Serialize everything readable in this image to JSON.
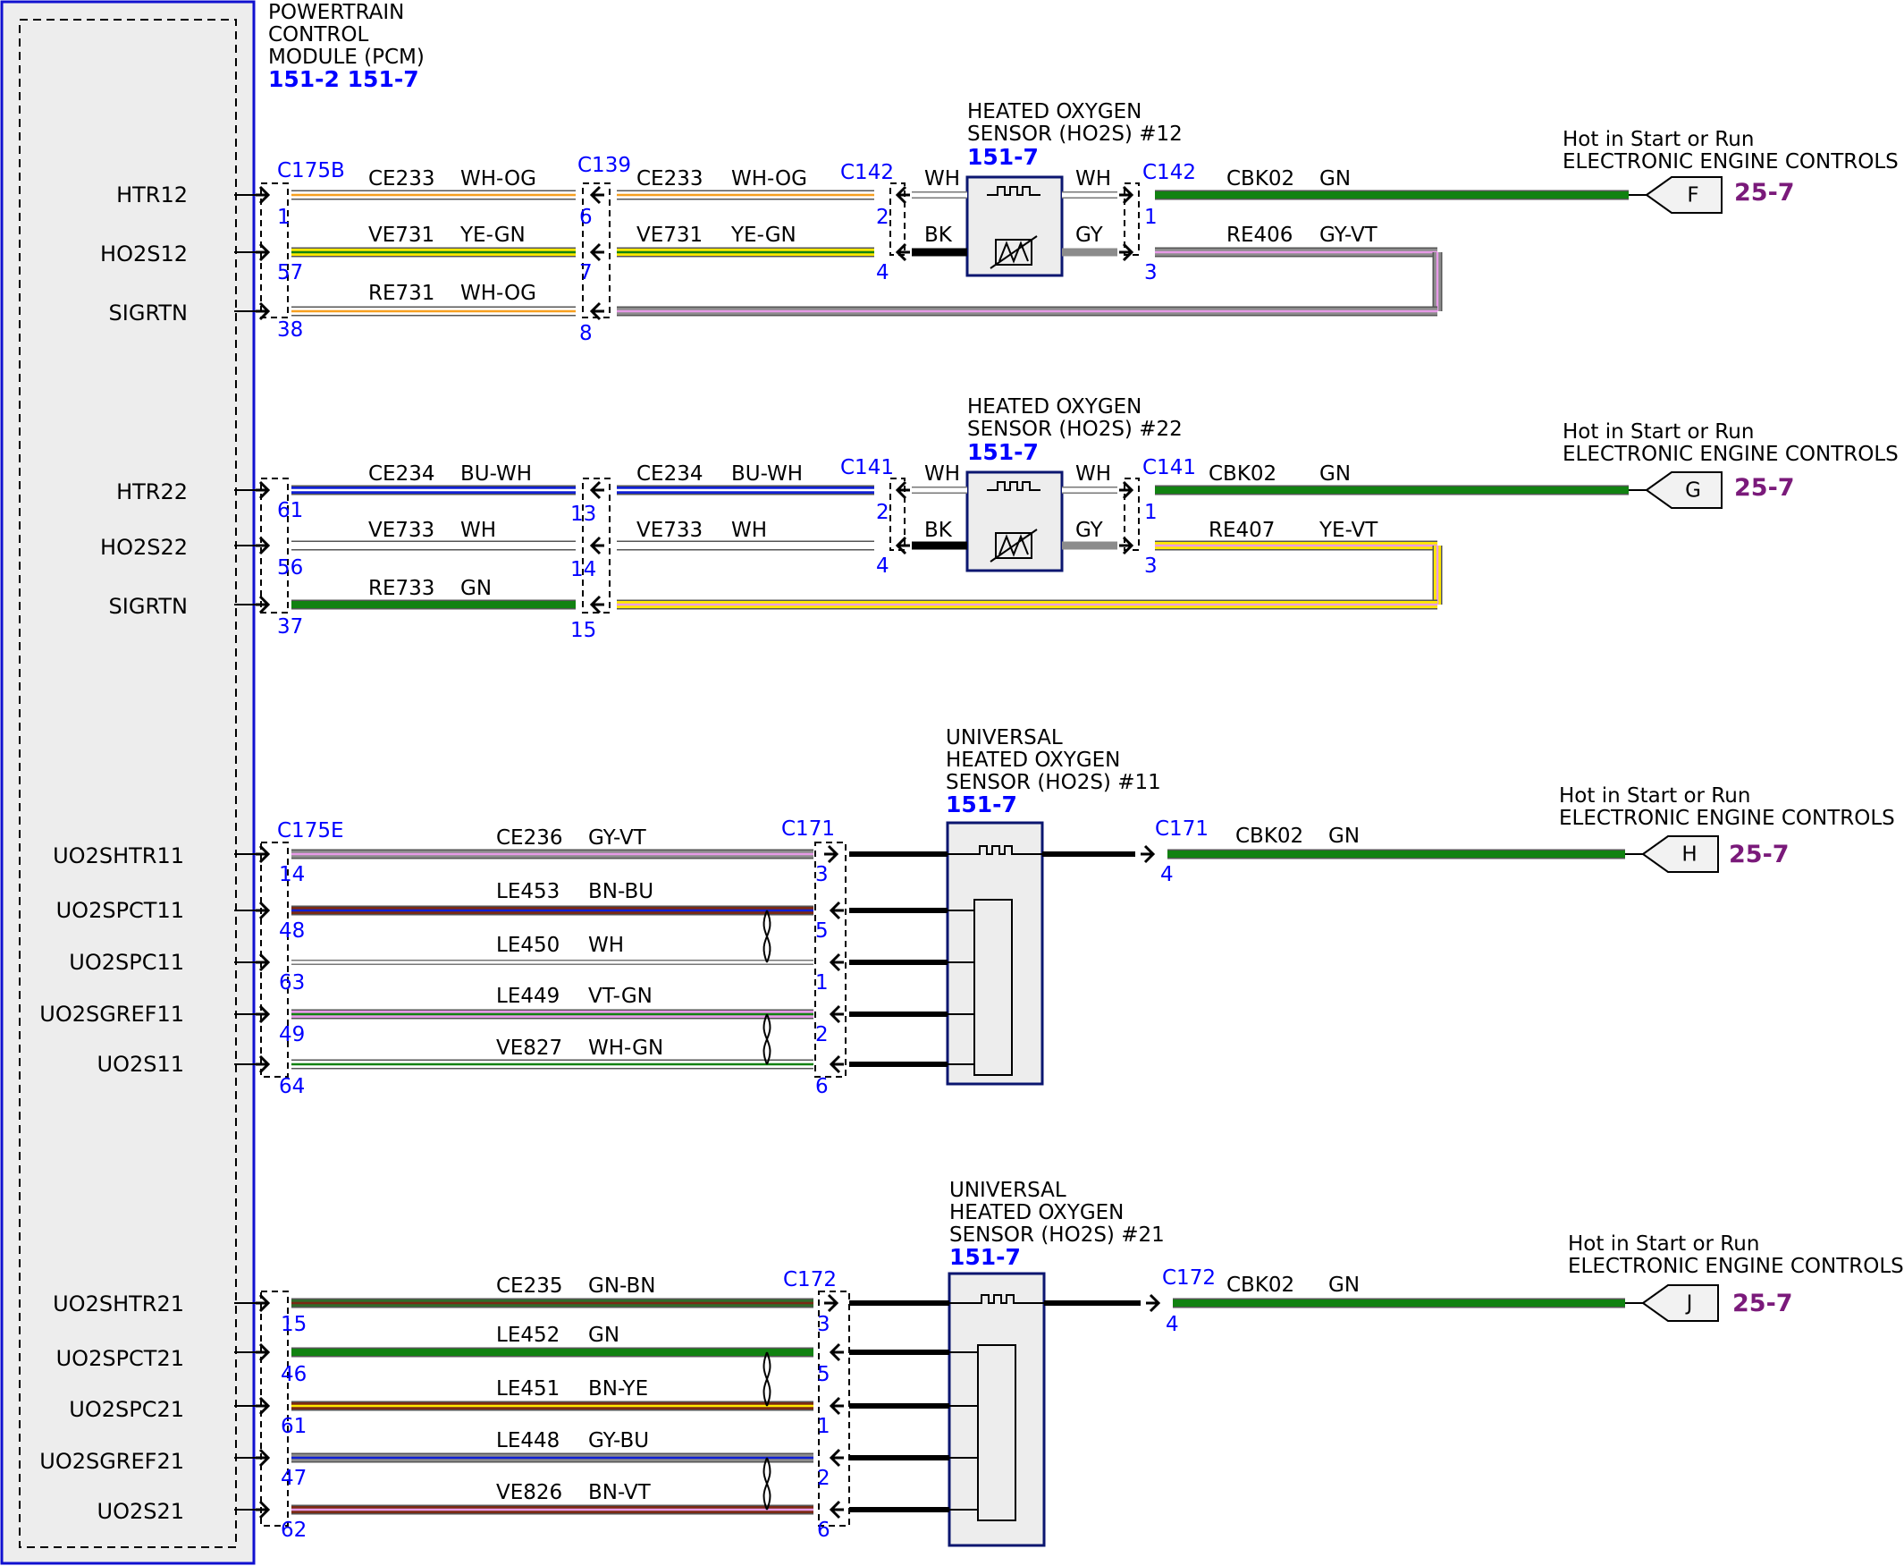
{
  "pcm": {
    "title": [
      "POWERTRAIN",
      "CONTROL",
      "MODULE (PCM)"
    ],
    "refs": "151-2 151-7"
  },
  "colors": {
    "WH": "#ffffff",
    "OG": "#f7a020",
    "YE": "#ffe800",
    "GN": "#118211",
    "GY": "#8c8c8c",
    "VT": "#e79ae7",
    "BU": "#0f1fd4",
    "BN": "#7a2a14",
    "BK": "#000000",
    "DKGN": "#2f6b2a"
  },
  "sections": [
    {
      "id": "ho2s12",
      "sensor_label": [
        "HEATED OXYGEN",
        "SENSOR (HO2S) #12"
      ],
      "sensor_ref": "151-7",
      "conn_pcm": "C175B",
      "conn_mid": "C139",
      "conn_sensor": "C142",
      "conn_out": "C142",
      "signals": [
        {
          "name": "HTR12",
          "pcm_pin": "1",
          "circuit": "CE233",
          "color": "WH-OG",
          "mid_pin": "6",
          "sensor_pin": "2",
          "lead": "WH"
        },
        {
          "name": "HO2S12",
          "pcm_pin": "57",
          "circuit": "VE731",
          "color": "YE-GN",
          "mid_pin": "7",
          "sensor_pin": "4",
          "lead": "BK"
        },
        {
          "name": "SIGRTN",
          "pcm_pin": "38",
          "circuit": "RE731",
          "color": "WH-OG",
          "mid_pin": "8"
        }
      ],
      "out": [
        {
          "pin": "1",
          "lead": "WH",
          "circuit": "CBK02",
          "color": "GN"
        },
        {
          "pin": "3",
          "lead": "GY",
          "circuit": "RE406",
          "color": "GY-VT"
        }
      ],
      "feed": {
        "label": [
          "Hot in Start or Run",
          "ELECTRONIC ENGINE CONTROLS"
        ],
        "letter": "F",
        "ref": "25-7"
      }
    },
    {
      "id": "ho2s22",
      "sensor_label": [
        "HEATED OXYGEN",
        "SENSOR (HO2S) #22"
      ],
      "sensor_ref": "151-7",
      "conn_sensor": "C141",
      "conn_out": "C141",
      "signals": [
        {
          "name": "HTR22",
          "pcm_pin": "61",
          "circuit": "CE234",
          "color": "BU-WH",
          "mid_pin": "13",
          "sensor_pin": "2",
          "lead": "WH"
        },
        {
          "name": "HO2S22",
          "pcm_pin": "56",
          "circuit": "VE733",
          "color": "WH",
          "mid_pin": "14",
          "sensor_pin": "4",
          "lead": "BK"
        },
        {
          "name": "SIGRTN",
          "pcm_pin": "37",
          "circuit": "RE733",
          "color": "GN",
          "mid_pin": "15"
        }
      ],
      "out": [
        {
          "pin": "1",
          "lead": "WH",
          "circuit": "CBK02",
          "color": "GN"
        },
        {
          "pin": "3",
          "lead": "GY",
          "circuit": "RE407",
          "color": "YE-VT"
        }
      ],
      "feed": {
        "label": [
          "Hot in Start or Run",
          "ELECTRONIC ENGINE CONTROLS"
        ],
        "letter": "G",
        "ref": "25-7"
      }
    },
    {
      "id": "uo2s11",
      "sensor_label": [
        "UNIVERSAL",
        "HEATED OXYGEN",
        "SENSOR (HO2S) #11"
      ],
      "sensor_ref": "151-7",
      "conn_pcm": "C175E",
      "conn_sensor": "C171",
      "conn_out": "C171",
      "signals": [
        {
          "name": "UO2SHTR11",
          "pcm_pin": "14",
          "circuit": "CE236",
          "color": "GY-VT",
          "sensor_pin": "3"
        },
        {
          "name": "UO2SPCT11",
          "pcm_pin": "48",
          "circuit": "LE453",
          "color": "BN-BU",
          "sensor_pin": "5"
        },
        {
          "name": "UO2SPC11",
          "pcm_pin": "63",
          "circuit": "LE450",
          "color": "WH",
          "sensor_pin": "1"
        },
        {
          "name": "UO2SGREF11",
          "pcm_pin": "49",
          "circuit": "LE449",
          "color": "VT-GN",
          "sensor_pin": "2"
        },
        {
          "name": "UO2S11",
          "pcm_pin": "64",
          "circuit": "VE827",
          "color": "WH-GN",
          "sensor_pin": "6"
        }
      ],
      "out": [
        {
          "pin": "4",
          "circuit": "CBK02",
          "color": "GN"
        }
      ],
      "feed": {
        "label": [
          "Hot in Start or Run",
          "ELECTRONIC ENGINE CONTROLS"
        ],
        "letter": "H",
        "ref": "25-7"
      }
    },
    {
      "id": "uo2s21",
      "sensor_label": [
        "UNIVERSAL",
        "HEATED OXYGEN",
        "SENSOR (HO2S) #21"
      ],
      "sensor_ref": "151-7",
      "conn_sensor": "C172",
      "conn_out": "C172",
      "signals": [
        {
          "name": "UO2SHTR21",
          "pcm_pin": "15",
          "circuit": "CE235",
          "color": "GN-BN",
          "sensor_pin": "3"
        },
        {
          "name": "UO2SPCT21",
          "pcm_pin": "46",
          "circuit": "LE452",
          "color": "GN",
          "sensor_pin": "5"
        },
        {
          "name": "UO2SPC21",
          "pcm_pin": "61",
          "circuit": "LE451",
          "color": "BN-YE",
          "sensor_pin": "1"
        },
        {
          "name": "UO2SGREF21",
          "pcm_pin": "47",
          "circuit": "LE448",
          "color": "GY-BU",
          "sensor_pin": "2"
        },
        {
          "name": "UO2S21",
          "pcm_pin": "62",
          "circuit": "VE826",
          "color": "BN-VT",
          "sensor_pin": "6"
        }
      ],
      "out": [
        {
          "pin": "4",
          "circuit": "CBK02",
          "color": "GN"
        }
      ],
      "feed": {
        "label": [
          "Hot in Start or Run",
          "ELECTRONIC ENGINE CONTROLS"
        ],
        "letter": "J",
        "ref": "25-7"
      }
    }
  ]
}
